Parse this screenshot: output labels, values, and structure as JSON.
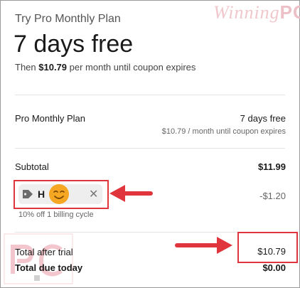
{
  "header": {
    "plan_label": "Try Pro Monthly Plan",
    "headline": "7 days free",
    "subtitle_prefix": "Then ",
    "subtitle_price": "$10.79",
    "subtitle_suffix": " per month until coupon expires"
  },
  "watermark": {
    "word": "Winning",
    "suffix": "PC"
  },
  "plan_row": {
    "label": "Pro Monthly Plan",
    "value": "7 days free",
    "detail": "$10.79 / month until coupon expires"
  },
  "subtotal": {
    "label": "Subtotal",
    "value": "$11.99"
  },
  "coupon": {
    "code": "H M",
    "remove_glyph": "✕",
    "discount": "-$1.20",
    "description": "10% off 1 billing cycle"
  },
  "totals": {
    "after_trial_label": "Total after trial",
    "after_trial_value": "$10.79",
    "due_today_label": "Total due today",
    "due_today_value": "$0.00"
  },
  "colors": {
    "highlight_red": "#e0353c",
    "emoji_yellow": "#f5a623"
  },
  "icons": {
    "coupon": "tag-icon",
    "remove": "close-icon",
    "annotation": "emoji-icon"
  }
}
